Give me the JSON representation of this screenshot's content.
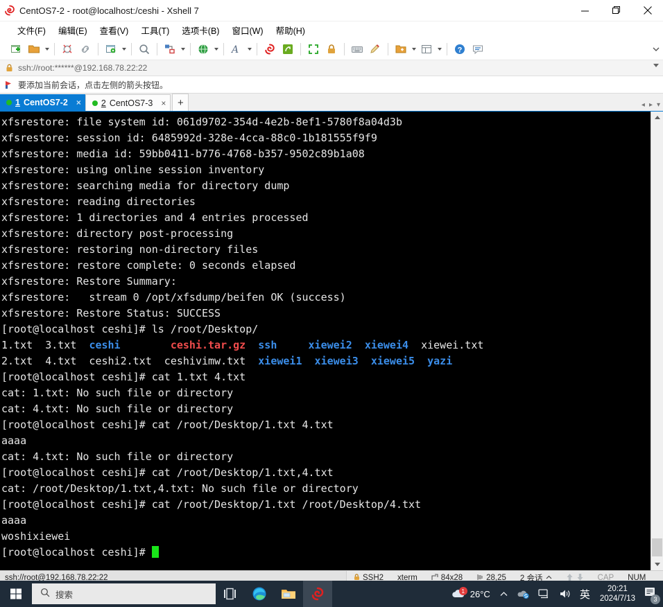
{
  "window": {
    "title": "CentOS7-2 - root@localhost:/ceshi - Xshell 7",
    "app_icon": "xshell-logo-icon",
    "controls": {
      "minimize": "—",
      "restore": "❐",
      "close": "✕"
    }
  },
  "menubar": {
    "items": [
      {
        "label": "文件(F)",
        "name": "menu-file"
      },
      {
        "label": "编辑(E)",
        "name": "menu-edit"
      },
      {
        "label": "查看(V)",
        "name": "menu-view"
      },
      {
        "label": "工具(T)",
        "name": "menu-tools"
      },
      {
        "label": "选项卡(B)",
        "name": "menu-tabs"
      },
      {
        "label": "窗口(W)",
        "name": "menu-window"
      },
      {
        "label": "帮助(H)",
        "name": "menu-help"
      }
    ]
  },
  "toolbar": {
    "icons": [
      "new-session-icon",
      "open-folder-icon",
      "disconnect-icon",
      "link-icon",
      "session-properties-icon",
      "find-icon",
      "transfer-icon",
      "globe-icon",
      "font-icon",
      "xshell-icon",
      "xftp-icon",
      "fullscreen-icon",
      "lock-icon",
      "keyboard-icon",
      "compose-icon",
      "new-folder-icon",
      "layout-icon",
      "help-icon",
      "feedback-icon"
    ],
    "overflow_label": "»"
  },
  "addressbar": {
    "lock_icon": "lock-icon",
    "value": "ssh://root:******@192.168.78.22:22"
  },
  "notice": {
    "icon": "arrow-flag-icon",
    "text": "要添加当前会话，点击左侧的箭头按钮。"
  },
  "tabs": {
    "items": [
      {
        "num": "1",
        "label": "CentOS7-2",
        "active": true,
        "close": "×"
      },
      {
        "num": "2",
        "label": "CentOS7-3",
        "active": false,
        "close": "×"
      }
    ],
    "add_label": "+",
    "nav_prev": "◂",
    "nav_next": "▸",
    "nav_menu": "▾"
  },
  "terminal": {
    "lines": [
      {
        "text": "xfsrestore: file system id: 061d9702-354d-4e2b-8ef1-5780f8a04d3b"
      },
      {
        "text": "xfsrestore: session id: 6485992d-328e-4cca-88c0-1b181555f9f9"
      },
      {
        "text": "xfsrestore: media id: 59bb0411-b776-4768-b357-9502c89b1a08"
      },
      {
        "text": "xfsrestore: using online session inventory"
      },
      {
        "text": "xfsrestore: searching media for directory dump"
      },
      {
        "text": "xfsrestore: reading directories"
      },
      {
        "text": "xfsrestore: 1 directories and 4 entries processed"
      },
      {
        "text": "xfsrestore: directory post-processing"
      },
      {
        "text": "xfsrestore: restoring non-directory files"
      },
      {
        "text": "xfsrestore: restore complete: 0 seconds elapsed"
      },
      {
        "text": "xfsrestore: Restore Summary:"
      },
      {
        "text": "xfsrestore:   stream 0 /opt/xfsdump/beifen OK (success)"
      },
      {
        "text": "xfsrestore: Restore Status: SUCCESS"
      },
      {
        "text": "[root@localhost ceshi]# ls /root/Desktop/"
      },
      {
        "segments": [
          {
            "t": "1.txt  3.txt  ",
            "c": "plain"
          },
          {
            "t": "ceshi",
            "c": "dir"
          },
          {
            "t": "        ",
            "c": "plain"
          },
          {
            "t": "ceshi.tar.gz",
            "c": "arc"
          },
          {
            "t": "  ",
            "c": "plain"
          },
          {
            "t": "ssh",
            "c": "dir"
          },
          {
            "t": "     ",
            "c": "plain"
          },
          {
            "t": "xiewei2",
            "c": "dir"
          },
          {
            "t": "  ",
            "c": "plain"
          },
          {
            "t": "xiewei4",
            "c": "dir"
          },
          {
            "t": "  xiewei.txt",
            "c": "plain"
          }
        ]
      },
      {
        "segments": [
          {
            "t": "2.txt  4.txt  ceshi2.txt  ceshivimw.txt  ",
            "c": "plain"
          },
          {
            "t": "xiewei1",
            "c": "dir"
          },
          {
            "t": "  ",
            "c": "plain"
          },
          {
            "t": "xiewei3",
            "c": "dir"
          },
          {
            "t": "  ",
            "c": "plain"
          },
          {
            "t": "xiewei5",
            "c": "dir"
          },
          {
            "t": "  ",
            "c": "plain"
          },
          {
            "t": "yazi",
            "c": "dir"
          }
        ]
      },
      {
        "text": "[root@localhost ceshi]# cat 1.txt 4.txt"
      },
      {
        "text": "cat: 1.txt: No such file or directory"
      },
      {
        "text": "cat: 4.txt: No such file or directory"
      },
      {
        "text": "[root@localhost ceshi]# cat /root/Desktop/1.txt 4.txt"
      },
      {
        "text": "aaaa"
      },
      {
        "text": "cat: 4.txt: No such file or directory"
      },
      {
        "text": "[root@localhost ceshi]# cat /root/Desktop/1.txt,4.txt"
      },
      {
        "text": "cat: /root/Desktop/1.txt,4.txt: No such file or directory"
      },
      {
        "text": "[root@localhost ceshi]# cat /root/Desktop/1.txt /root/Desktop/4.txt"
      },
      {
        "text": "aaaa"
      },
      {
        "text": "woshixiewei"
      },
      {
        "text": "[root@localhost ceshi]# ",
        "cursor": true
      }
    ],
    "colors": {
      "background": "#000000",
      "foreground": "#e6e6e6",
      "directory": "#3b8eea",
      "archive": "#f14c4c",
      "cursor": "#19e619"
    }
  },
  "statusbar": {
    "connection": "ssh://root@192.168.78.22:22",
    "protocol": "SSH2",
    "terminal_type": "xterm",
    "size": "84x28",
    "cursor_pos": "28,25",
    "sessions": "2 会话",
    "cap": "CAP",
    "num": "NUM",
    "lock_icon": "lock-icon",
    "resize_icon": "resize-icon",
    "cursor_icon": "cursor-icon",
    "expand_icon": "chevron-up-icon",
    "up_icon": "arrow-up-icon",
    "down_icon": "arrow-down-icon"
  },
  "taskbar": {
    "start_icon": "windows-start-icon",
    "search": {
      "icon": "search-icon",
      "placeholder": "搜索"
    },
    "apps": [
      {
        "name": "task-view-icon"
      },
      {
        "name": "edge-browser-icon"
      },
      {
        "name": "file-explorer-icon"
      },
      {
        "name": "xshell-taskbar-icon",
        "active": true
      }
    ],
    "tray": {
      "weather_icon": "cloud-weather-icon",
      "weather_badge": "1",
      "weather_temp": "26°C",
      "overflow_icon": "chevron-up-icon",
      "onedrive_icon": "onedrive-icon",
      "network_icon": "network-icon",
      "volume_icon": "volume-icon",
      "ime_label": "英",
      "time": "20:21",
      "date": "2024/7/13",
      "notification_icon": "notification-icon",
      "notification_badge": "3"
    }
  }
}
